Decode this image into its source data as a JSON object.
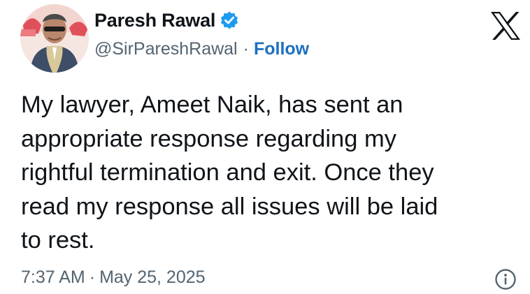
{
  "author": {
    "display_name": "Paresh Rawal",
    "handle": "@SirPareshRawal",
    "separator": "·",
    "follow_label": "Follow",
    "verified_icon": "verified-badge-icon",
    "avatar_icon": "profile-avatar"
  },
  "brand": {
    "logo_icon": "x-logo-icon"
  },
  "tweet": {
    "lines": [
      "My lawyer, Ameet Naik, has sent an",
      "appropriate response regarding my",
      "rightful termination and exit. Once they",
      "read my response all issues will be laid",
      "to rest."
    ]
  },
  "meta": {
    "time": "7:37 AM",
    "separator": "·",
    "date": "May 25, 2025",
    "info_icon": "info-icon"
  },
  "colors": {
    "text": "#0f1419",
    "secondary": "#536471",
    "link": "#1d6fbf",
    "verified": "#1d9bf0"
  }
}
